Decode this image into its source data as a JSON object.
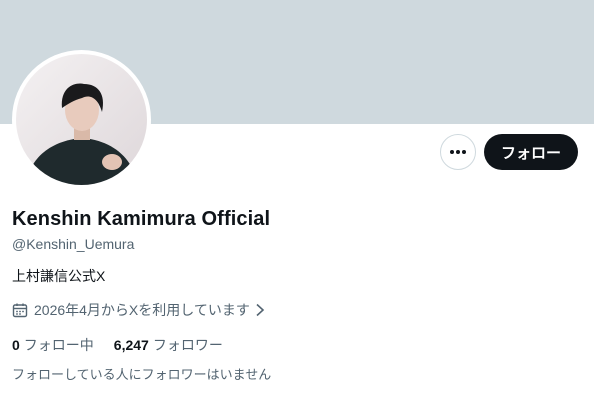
{
  "profile": {
    "display_name": "Kenshin Kamimura Official",
    "handle": "@Kenshin_Uemura",
    "bio": "上村謙信公式X",
    "joined": "2026年4月からXを利用しています"
  },
  "actions": {
    "follow_label": "フォロー",
    "more_icon": "more-horizontal-icon"
  },
  "stats": {
    "following_count": "0",
    "following_label": "フォロー中",
    "followers_count": "6,247",
    "followers_label": "フォロワー"
  },
  "mutuals_note": "フォローしている人にフォロワーはいません",
  "colors": {
    "banner": "#cfd9de",
    "primary_text": "#0f1419",
    "secondary_text": "#536471",
    "follow_button_bg": "#0f1419"
  }
}
